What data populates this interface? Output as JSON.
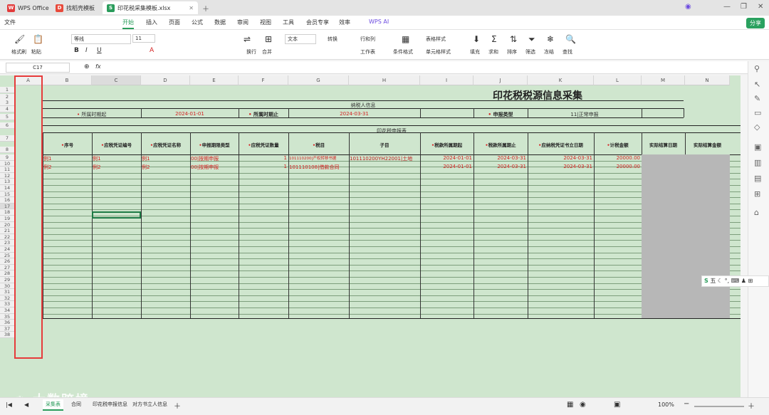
{
  "tabs": [
    {
      "label": "WPS Office"
    },
    {
      "label": "找稻壳模板"
    },
    {
      "label": "印花税采集模板.xlsx"
    }
  ],
  "menu": [
    "文件",
    "开始",
    "插入",
    "页面",
    "公式",
    "数据",
    "审阅",
    "视图",
    "工具",
    "会员专享",
    "效率",
    "WPS AI"
  ],
  "share_label": "分享",
  "ribbon": {
    "format_painter": "格式刷",
    "paste": "粘贴",
    "font_name": "等线",
    "font_size": "11",
    "wrap": "换行",
    "merge": "合并",
    "text": "文本",
    "convert": "转换",
    "rowcol": "行和列",
    "worksheet": "工作表",
    "cond_format": "条件格式",
    "table_style": "表格样式",
    "cell_style": "单元格样式",
    "fill": "填充",
    "sum": "求和",
    "sort": "排序",
    "filter": "筛选",
    "freeze": "冻结",
    "find": "查找"
  },
  "formula": {
    "namebox": "C17",
    "fx": "fx"
  },
  "columns": [
    "A",
    "B",
    "C",
    "D",
    "E",
    "F",
    "G",
    "H",
    "I",
    "J",
    "K",
    "L",
    "M",
    "N"
  ],
  "rows": [
    "1",
    "2",
    "3",
    "4",
    "5",
    "6",
    "7",
    "8",
    "9",
    "10",
    "11",
    "12",
    "13",
    "14",
    "15",
    "16",
    "17",
    "18",
    "19",
    "20",
    "21",
    "22",
    "23",
    "24",
    "25",
    "26",
    "27",
    "28",
    "29",
    "30",
    "31",
    "32",
    "33",
    "34",
    "35",
    "36",
    "37",
    "38"
  ],
  "sheet": {
    "title": "印花税税源信息采集",
    "taxpayer_header": "纳税人信息",
    "period_start_label": "所属时期起",
    "period_start": "2024-01-01",
    "period_end_label": "所属时期止",
    "period_end": "2024-03-31",
    "report_type_label": "申报类型",
    "report_type": "11|正常申报",
    "report_header": "印花税申报表",
    "headers": [
      "序号",
      "应税凭证编号",
      "应税凭证名称",
      "申报期限类型",
      "应税凭证数量",
      "税目",
      "子目",
      "税款所属期起",
      "税款所属期止",
      "应纳税凭证书立日期",
      "计税金额",
      "实际结算日期",
      "实际结算金额"
    ],
    "rows": [
      [
        "例1",
        "例1",
        "例1",
        "00|按期申报",
        "1",
        "101110200|产权转移书据",
        "101110200YH22001|土地",
        "2024-01-01",
        "2024-03-31",
        "2024-03-31",
        "20000.00"
      ],
      [
        "例2",
        "例2",
        "例2",
        "00|按期申报",
        "1",
        "101110108|借款合同",
        "",
        "2024-01-01",
        "2024-03-31",
        "2024-03-31",
        "20000.00"
      ]
    ]
  },
  "sheet_tabs": [
    "采集表",
    "合同",
    "印花税申报信息",
    "对方书立人信息"
  ],
  "zoom": "100%",
  "ime": "五",
  "watermark": "大数跨境"
}
